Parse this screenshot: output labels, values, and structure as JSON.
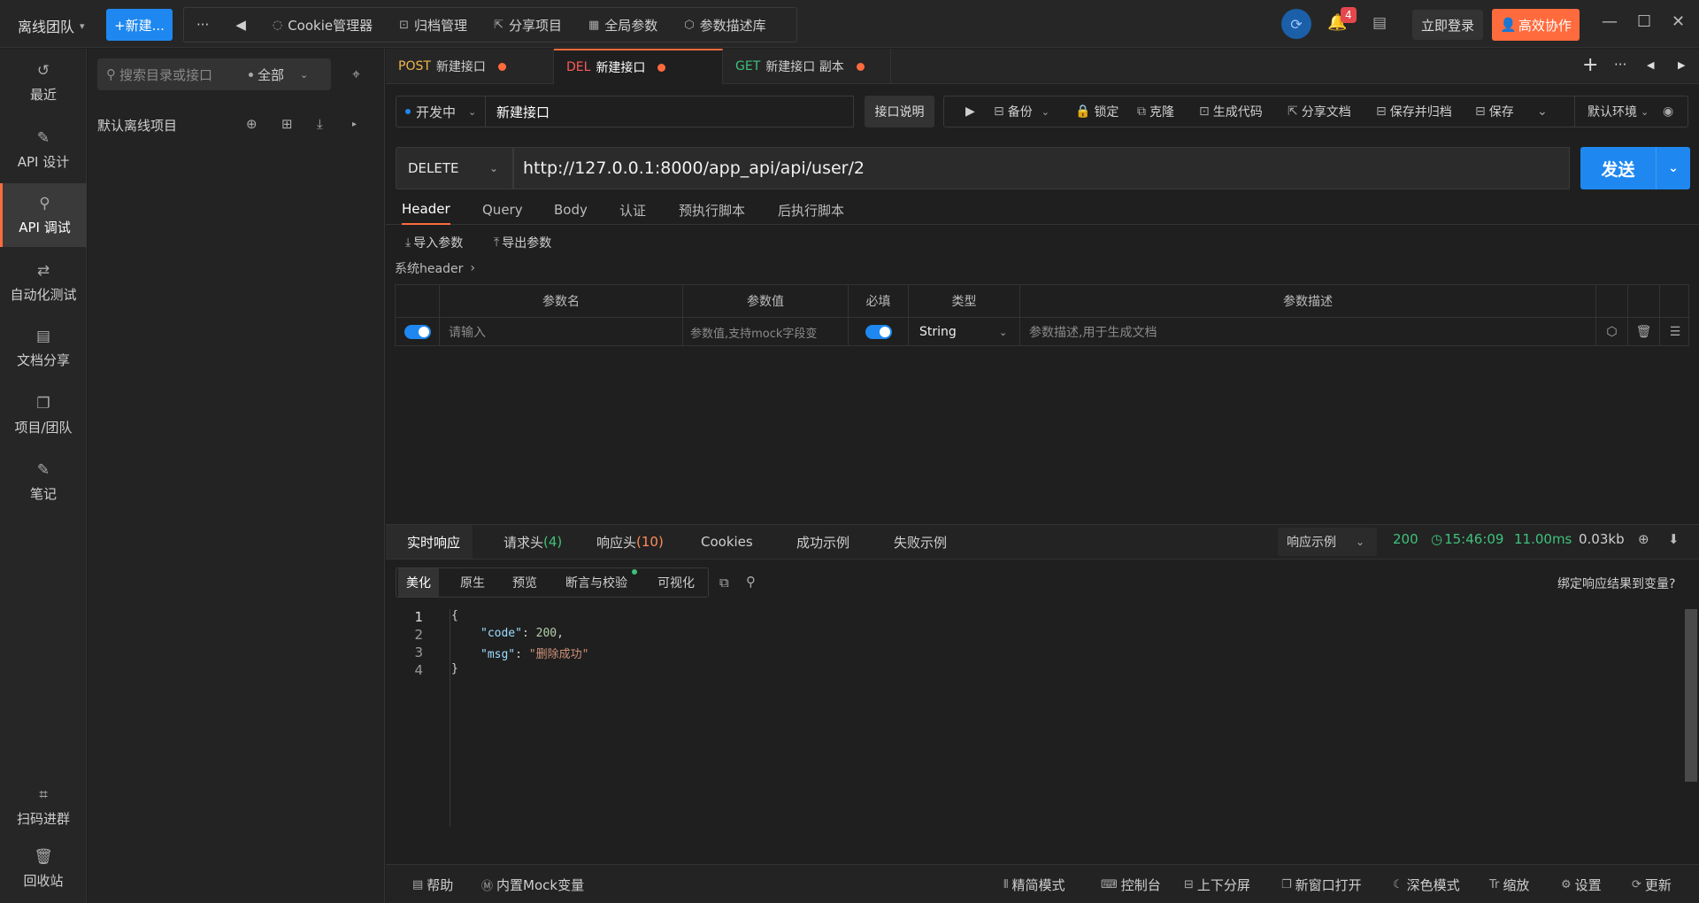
{
  "topbar": {
    "team": "离线团队",
    "new_button": "+新建...",
    "more_icon": "···",
    "tools": [
      "Cookie管理器",
      "归档管理",
      "分享项目",
      "全局参数",
      "参数描述库"
    ],
    "notif_count": "4",
    "login": "立即登录",
    "collab": "高效协作"
  },
  "rail": {
    "items": [
      "最近",
      "API 设计",
      "API 调试",
      "自动化测试",
      "文档分享",
      "项目/团队",
      "笔记"
    ],
    "scan": "扫码进群",
    "recycle": "回收站"
  },
  "tree": {
    "search_placeholder": "搜索目录或接口",
    "filter": "全部",
    "project": "默认离线项目"
  },
  "tabs": [
    {
      "method": "POST",
      "name": "新建接口"
    },
    {
      "method": "DEL",
      "name": "新建接口"
    },
    {
      "method": "GET",
      "name": "新建接口 副本"
    }
  ],
  "apibar": {
    "status": "开发中",
    "name": "新建接口",
    "desc_btn": "接口说明",
    "actions": [
      "备份",
      "锁定",
      "克隆",
      "生成代码",
      "分享文档",
      "保存并归档",
      "保存"
    ],
    "env": "默认环境"
  },
  "request": {
    "method": "DELETE",
    "url": "http://127.0.0.1:8000/app_api/api/user/2",
    "send": "发送",
    "tabs": [
      "Header",
      "Query",
      "Body",
      "认证",
      "预执行脚本",
      "后执行脚本"
    ],
    "import": "导入参数",
    "export": "导出参数",
    "system_header": "系统header"
  },
  "params_table": {
    "headers": [
      "参数名",
      "参数值",
      "必填",
      "类型",
      "参数描述"
    ],
    "row": {
      "name_placeholder": "请输入",
      "value_placeholder": "参数值,支持mock字段变",
      "type": "String",
      "desc_placeholder": "参数描述,用于生成文档"
    }
  },
  "response": {
    "tabs": [
      "实时响应",
      "请求头",
      "响应头",
      "Cookies",
      "成功示例",
      "失败示例"
    ],
    "req_headers_count": "(4)",
    "resp_headers_count": "(10)",
    "example": "响应示例",
    "status": "200",
    "time": "15:46:09",
    "duration": "11.00ms",
    "size": "0.03kb",
    "formats": [
      "美化",
      "原生",
      "预览",
      "断言与校验",
      "可视化"
    ],
    "bind": "绑定响应结果到变量?",
    "code_lines": [
      "1",
      "2",
      "3",
      "4"
    ],
    "code_key1": "\"code\"",
    "code_val1": "200",
    "code_key2": "\"msg\"",
    "code_val2": "\"删除成功\""
  },
  "bottombar": {
    "left": [
      "帮助",
      "内置Mock变量"
    ],
    "right": [
      "精简模式",
      "控制台",
      "上下分屏",
      "新窗口打开",
      "深色模式",
      "缩放",
      "设置",
      "更新"
    ]
  },
  "colors": {
    "accent": "#ff6b3d",
    "primary": "#1e88f0",
    "success": "#3ec27a"
  }
}
